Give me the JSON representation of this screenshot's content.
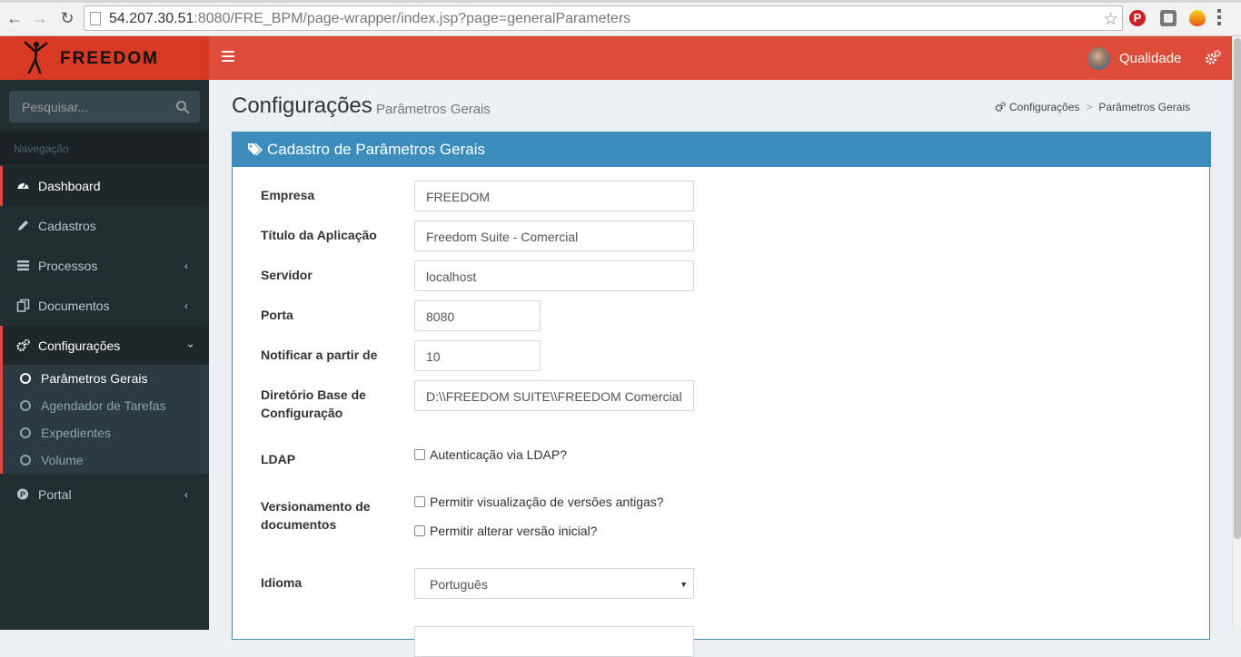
{
  "browser": {
    "url_host": "54.207.30.51",
    "url_rest": ":8080/FRE_BPM/page-wrapper/index.jsp?page=generalParameters"
  },
  "header": {
    "logo_text": "FREEDOM",
    "user_name": "Qualidade",
    "colors": {
      "header": "#dd4b39",
      "logo_bg": "#d73925"
    }
  },
  "sidebar": {
    "search_placeholder": "Pesquisar...",
    "nav_header": "Navegação",
    "items": [
      {
        "label": "Dashboard",
        "icon": "dashboard-icon"
      },
      {
        "label": "Cadastros",
        "icon": "pencil-icon"
      },
      {
        "label": "Processos",
        "icon": "list-icon"
      },
      {
        "label": "Documentos",
        "icon": "files-icon"
      },
      {
        "label": "Configurações",
        "icon": "gears-icon"
      },
      {
        "label": "Portal",
        "icon": "pinterest-icon"
      }
    ],
    "submenu": [
      {
        "label": "Parâmetros Gerais"
      },
      {
        "label": "Agendador de Tarefas"
      },
      {
        "label": "Expedientes"
      },
      {
        "label": "Volume"
      }
    ]
  },
  "page": {
    "title": "Configurações",
    "subtitle": "Parâmetros Gerais",
    "breadcrumb": [
      "Configurações",
      "Parâmetros Gerais"
    ]
  },
  "form": {
    "box_title": "Cadastro de Parâmetros Gerais",
    "fields": {
      "empresa": {
        "label": "Empresa",
        "value": "FREEDOM"
      },
      "titulo": {
        "label": "Título da Aplicação",
        "value": "Freedom Suite - Comercial"
      },
      "servidor": {
        "label": "Servidor",
        "value": "localhost"
      },
      "porta": {
        "label": "Porta",
        "value": "8080"
      },
      "notificar": {
        "label": "Notificar a partir de",
        "value": "10"
      },
      "diretorio": {
        "label_line1": "Diretório Base de",
        "label_line2": "Configuração",
        "value": "D:\\\\FREEDOM SUITE\\\\FREEDOM Comercial"
      },
      "ldap": {
        "label": "LDAP",
        "checkbox": "Autenticação via LDAP?"
      },
      "versionamento": {
        "label_line1": "Versionamento de",
        "label_line2": "documentos",
        "checkbox1": "Permitir visualização de versões antigas?",
        "checkbox2": "Permitir alterar versão inicial?"
      },
      "idioma": {
        "label": "Idioma",
        "value": "Português"
      }
    }
  }
}
